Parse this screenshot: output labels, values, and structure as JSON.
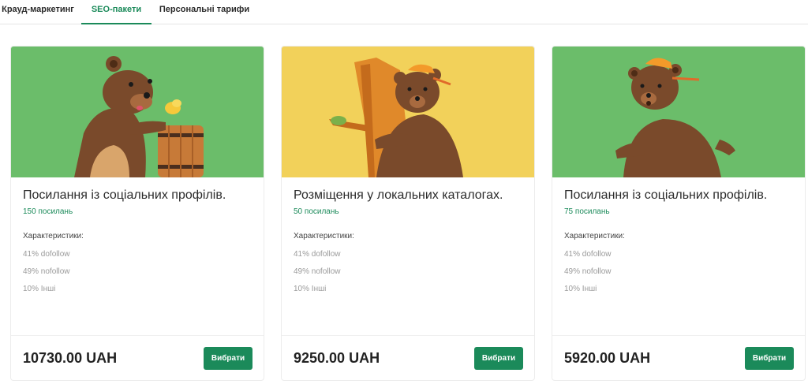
{
  "tabs": [
    {
      "label": "Крауд-маркетинг",
      "active": false
    },
    {
      "label": "SEO-пакети",
      "active": true
    },
    {
      "label": "Персональні тарифи",
      "active": false
    }
  ],
  "colors": {
    "accent": "#1b8a5a",
    "green_bg": "#6bbd6a",
    "yellow_bg": "#f2d15a",
    "bear": "#7a4a2b"
  },
  "cards": [
    {
      "image": "bear-with-honey-barrel",
      "title": "Посилання із соціальних профілів.",
      "count": "150 посилань",
      "characteristics_label": "Характеристики:",
      "lines": [
        "41% dofollow",
        "49% nofollow",
        "10% Інші"
      ],
      "price": "10730.00 UAH",
      "button": "Вибрати"
    },
    {
      "image": "bear-hugging-tree",
      "title": "Розміщення у локальних каталогах.",
      "count": "50 посилань",
      "characteristics_label": "Характеристики:",
      "lines": [
        "41% dofollow",
        "49% nofollow",
        "10% Інші"
      ],
      "price": "9250.00 UAH",
      "button": "Вибрати"
    },
    {
      "image": "bear-with-cap",
      "title": "Посилання із соціальних профілів.",
      "count": "75 посилань",
      "characteristics_label": "Характеристики:",
      "lines": [
        "41% dofollow",
        "49% nofollow",
        "10% Інші"
      ],
      "price": "5920.00 UAH",
      "button": "Вибрати"
    }
  ]
}
